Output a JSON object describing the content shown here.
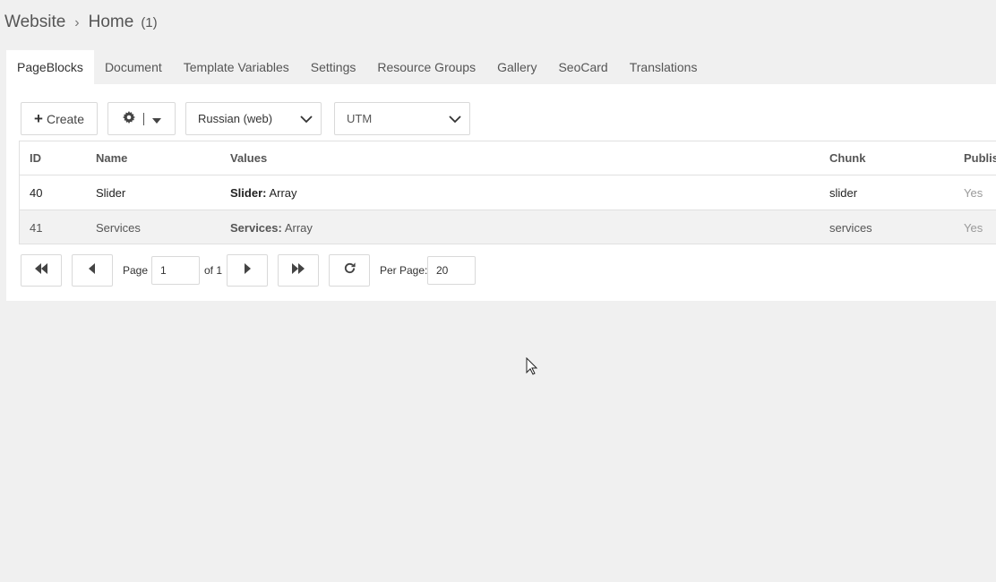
{
  "breadcrumb": {
    "root": "Website",
    "current": "Home",
    "count": "(1)"
  },
  "tabs": [
    {
      "label": "PageBlocks",
      "active": true
    },
    {
      "label": "Document"
    },
    {
      "label": "Template Variables"
    },
    {
      "label": "Settings"
    },
    {
      "label": "Resource Groups"
    },
    {
      "label": "Gallery"
    },
    {
      "label": "SeoCard"
    },
    {
      "label": "Translations"
    }
  ],
  "toolbar": {
    "create_label": "Create",
    "language_select": "Russian (web)",
    "utm_select": "UTM"
  },
  "grid": {
    "columns": [
      "ID",
      "Name",
      "Values",
      "Chunk",
      "Publis"
    ],
    "rows": [
      {
        "id": "40",
        "name": "Slider",
        "value_key": "Slider:",
        "value": "Array",
        "chunk": "slider",
        "published": "Yes"
      },
      {
        "id": "41",
        "name": "Services",
        "value_key": "Services:",
        "value": "Array",
        "chunk": "services",
        "published": "Yes"
      }
    ]
  },
  "pager": {
    "page_label": "Page",
    "page_value": "1",
    "of_label": "of 1",
    "per_page_label": "Per Page:",
    "per_page_value": "20"
  }
}
